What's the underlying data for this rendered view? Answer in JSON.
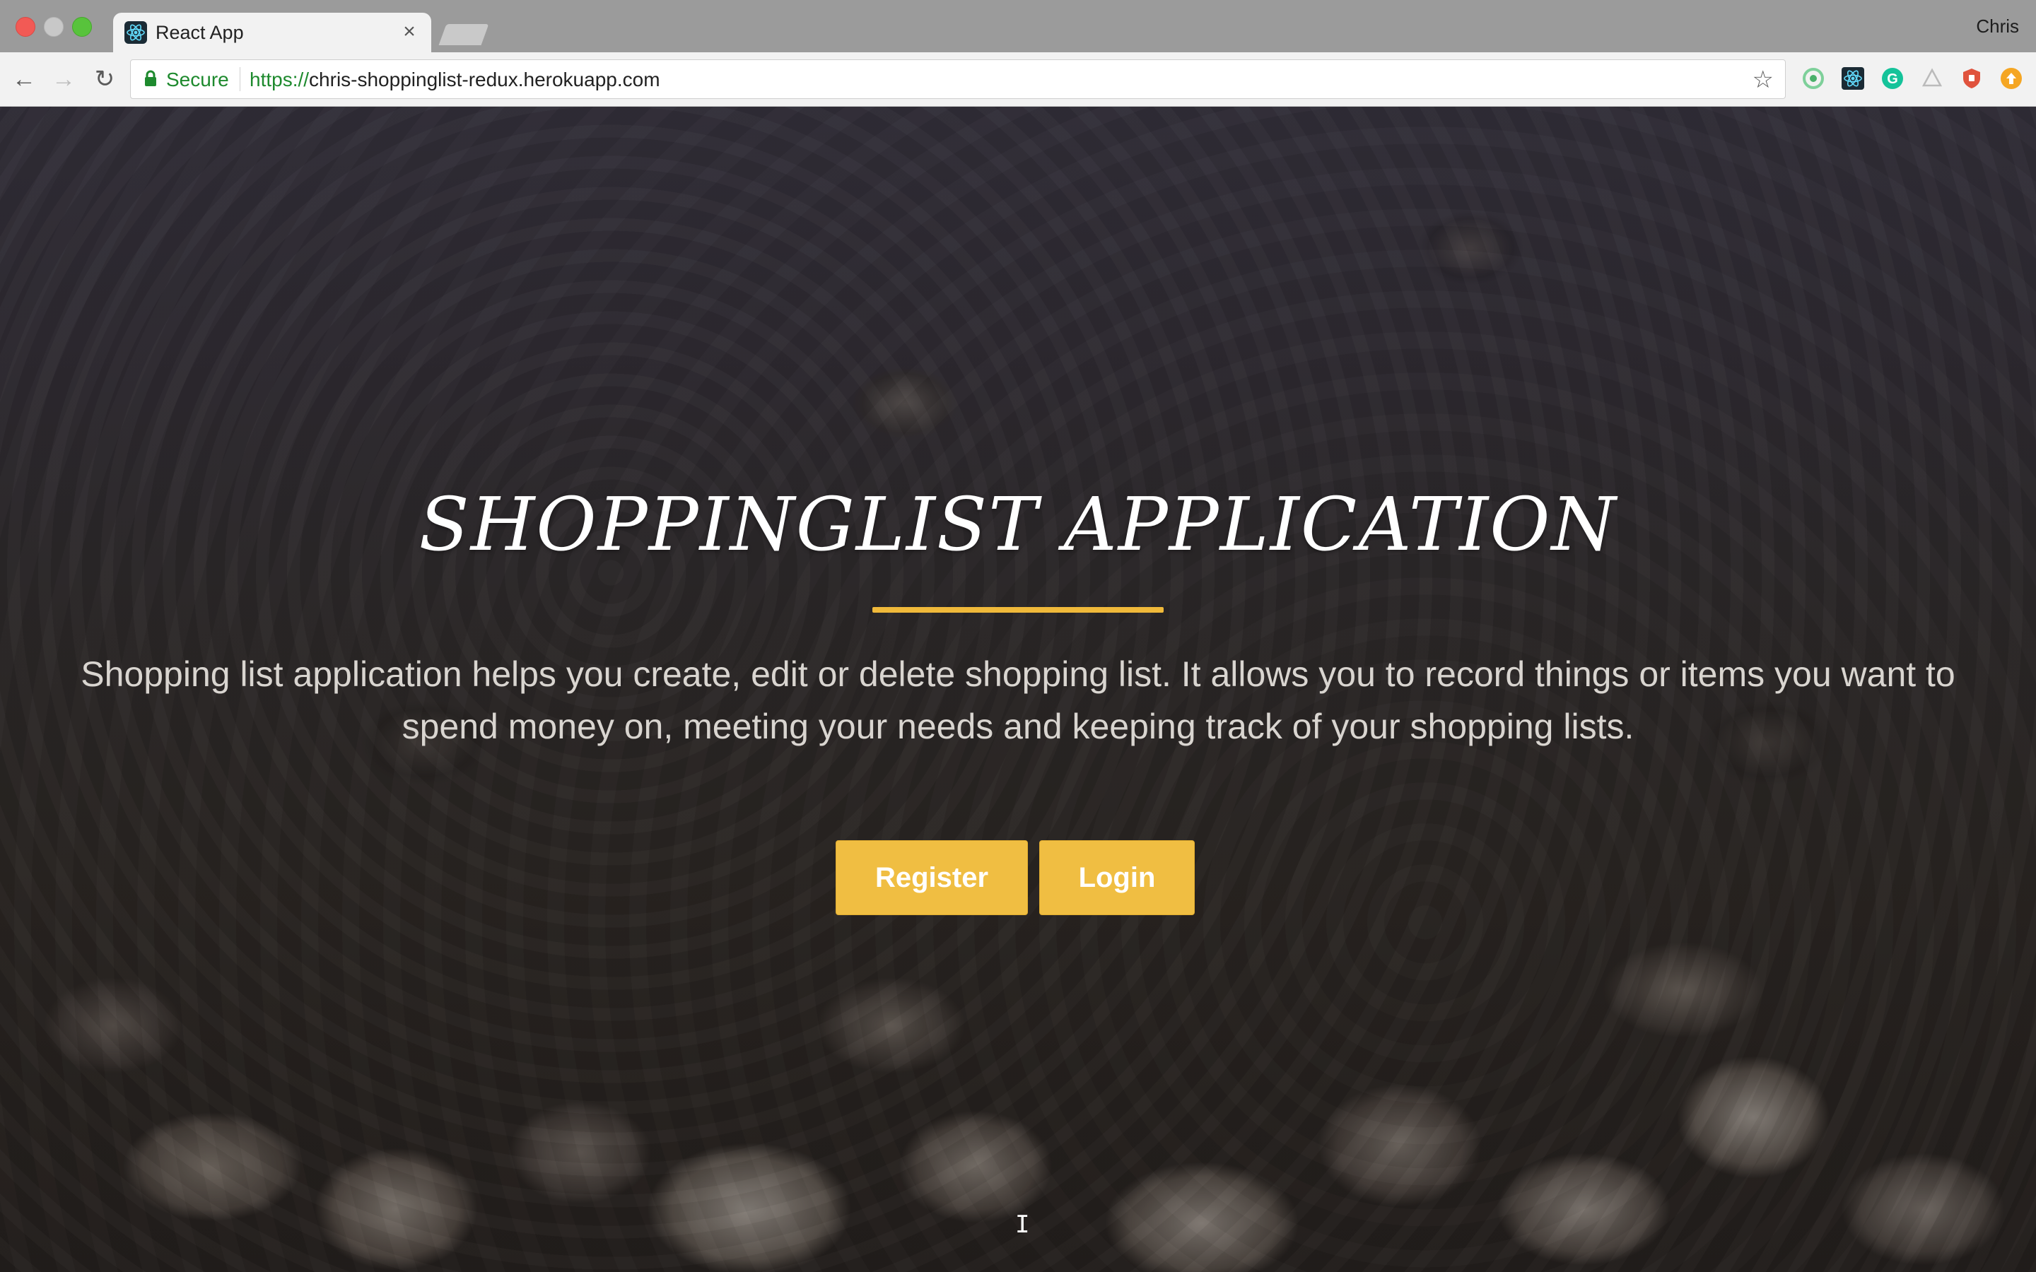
{
  "browser": {
    "tab_title": "React App",
    "tab_close": "×",
    "profile_name": "Chris",
    "secure_label": "Secure",
    "url_scheme": "https://",
    "url_host": "chris-shoppinglist-redux.herokuapp.com",
    "extensions": [
      "refresh-ext-icon",
      "react-devtools-icon",
      "grammarly-icon",
      "ext-icon",
      "shield-ext-icon",
      "update-ext-icon"
    ]
  },
  "hero": {
    "title": "SHOPPINGLIST APPLICATION",
    "description": "Shopping list application helps you create, edit or delete shopping list. It allows you to record things or items you want to spend money on, meeting your needs and keeping track of your shopping lists.",
    "register_label": "Register",
    "login_label": "Login"
  },
  "colors": {
    "accent": "#f0be42",
    "secure_green": "#1e8a2e"
  }
}
